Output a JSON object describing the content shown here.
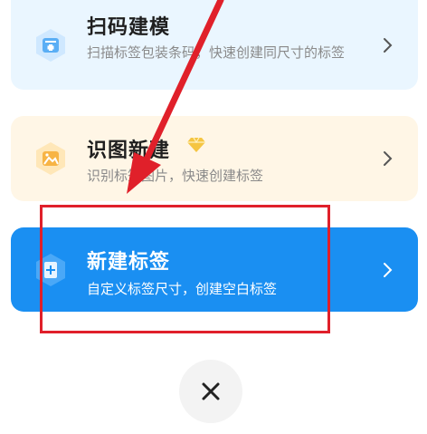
{
  "menu": {
    "scan": {
      "title": "扫码建模",
      "desc": "扫描标签包装条码，快速创建同尺寸的标签",
      "icon": "scan-template-icon"
    },
    "image": {
      "title": "识图新建",
      "desc": "识别标签图片，快速创建标签",
      "icon": "image-recognize-icon",
      "badge_icon": "diamond-vip-icon"
    },
    "new": {
      "title": "新建标签",
      "desc": "自定义标签尺寸，创建空白标签",
      "icon": "new-label-icon"
    }
  },
  "close": {
    "icon": "close-icon"
  },
  "colors": {
    "accent_blue": "#1a8ff2",
    "annotation_red": "#e0202a"
  }
}
